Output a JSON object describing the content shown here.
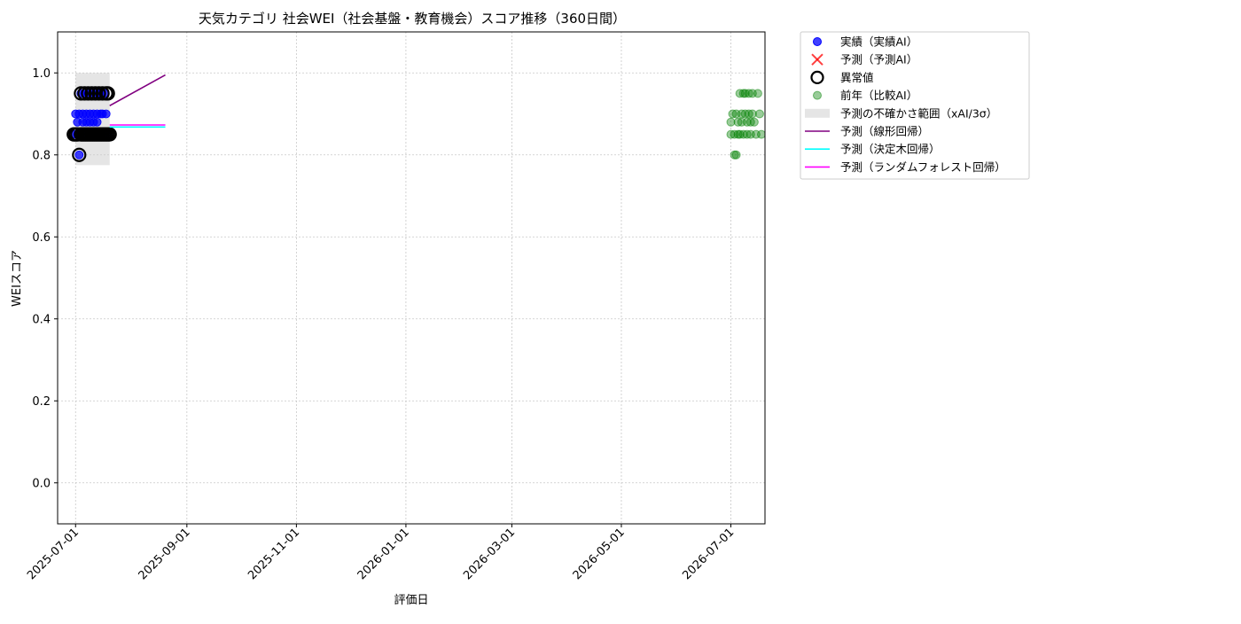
{
  "chart_data": {
    "type": "scatter",
    "title": "天気カテゴリ 社会WEI（社会基盤・教育機会）スコア推移（360日間）",
    "xlabel": "評価日",
    "ylabel": "WEIスコア",
    "xlim": [
      "2025-06-21",
      "2026-07-20"
    ],
    "ylim": [
      -0.1,
      1.1
    ],
    "xticks": [
      "2025-07-01",
      "2025-09-01",
      "2025-11-01",
      "2026-01-01",
      "2026-03-01",
      "2026-05-01",
      "2026-07-01"
    ],
    "yticks": [
      0.0,
      0.2,
      0.4,
      0.6,
      0.8,
      1.0
    ],
    "ytick_labels": [
      "0.0",
      "0.2",
      "0.4",
      "0.6",
      "0.8",
      "1.0"
    ],
    "grid": true,
    "legend_position": "outside-top-right",
    "colors": {
      "actual": "#0000ff",
      "predicted": "#ff0000",
      "anomaly": "#000000",
      "previous_year": "#008000",
      "band": "#cccccc",
      "linear": "#800080",
      "tree": "#00ffff",
      "forest": "#ff00ff"
    },
    "legend": [
      {
        "key": "actual",
        "label": "実績（実績AI）",
        "marker": "dot"
      },
      {
        "key": "predicted",
        "label": "予測（予測AI）",
        "marker": "x"
      },
      {
        "key": "anomaly",
        "label": "異常値",
        "marker": "ring"
      },
      {
        "key": "previous_year",
        "label": "前年（比較AI）",
        "marker": "dot-faint"
      },
      {
        "key": "band",
        "label": "予測の不確かさ範囲（xAI/3σ）",
        "marker": "patch"
      },
      {
        "key": "linear",
        "label": "予測（線形回帰）",
        "marker": "line"
      },
      {
        "key": "tree",
        "label": "予測（決定木回帰）",
        "marker": "line"
      },
      {
        "key": "forest",
        "label": "予測（ランダムフォレスト回帰）",
        "marker": "line"
      }
    ],
    "series": [
      {
        "key": "actual",
        "label": "実績（実績AI）",
        "points": [
          [
            "2025-07-01",
            0.85
          ],
          [
            "2025-07-01",
            0.9
          ],
          [
            "2025-07-02",
            0.88
          ],
          [
            "2025-07-02",
            0.85
          ],
          [
            "2025-07-03",
            0.8
          ],
          [
            "2025-07-03",
            0.9
          ],
          [
            "2025-07-04",
            0.95
          ],
          [
            "2025-07-04",
            0.85
          ],
          [
            "2025-07-05",
            0.88
          ],
          [
            "2025-07-05",
            0.9
          ],
          [
            "2025-07-06",
            0.95
          ],
          [
            "2025-07-06",
            0.85
          ],
          [
            "2025-07-07",
            0.9
          ],
          [
            "2025-07-07",
            0.88
          ],
          [
            "2025-07-08",
            0.95
          ],
          [
            "2025-07-08",
            0.85
          ],
          [
            "2025-07-09",
            0.9
          ],
          [
            "2025-07-09",
            0.88
          ],
          [
            "2025-07-10",
            0.95
          ],
          [
            "2025-07-10",
            0.85
          ],
          [
            "2025-07-11",
            0.9
          ],
          [
            "2025-07-11",
            0.88
          ],
          [
            "2025-07-12",
            0.95
          ],
          [
            "2025-07-12",
            0.85
          ],
          [
            "2025-07-13",
            0.9
          ],
          [
            "2025-07-13",
            0.88
          ],
          [
            "2025-07-14",
            0.95
          ],
          [
            "2025-07-14",
            0.85
          ],
          [
            "2025-07-15",
            0.9
          ],
          [
            "2025-07-15",
            0.95
          ],
          [
            "2025-07-16",
            0.85
          ],
          [
            "2025-07-16",
            0.9
          ],
          [
            "2025-07-17",
            0.95
          ],
          [
            "2025-07-17",
            0.85
          ],
          [
            "2025-07-18",
            0.9
          ],
          [
            "2025-07-19",
            0.85
          ]
        ]
      },
      {
        "key": "anomaly",
        "label": "異常値",
        "points": [
          [
            "2025-06-30",
            0.85
          ],
          [
            "2025-07-01",
            0.85
          ],
          [
            "2025-07-02",
            0.85
          ],
          [
            "2025-07-03",
            0.8
          ],
          [
            "2025-07-04",
            0.85
          ],
          [
            "2025-07-04",
            0.95
          ],
          [
            "2025-07-05",
            0.85
          ],
          [
            "2025-07-06",
            0.95
          ],
          [
            "2025-07-06",
            0.85
          ],
          [
            "2025-07-07",
            0.85
          ],
          [
            "2025-07-08",
            0.95
          ],
          [
            "2025-07-08",
            0.85
          ],
          [
            "2025-07-09",
            0.85
          ],
          [
            "2025-07-10",
            0.95
          ],
          [
            "2025-07-10",
            0.85
          ],
          [
            "2025-07-11",
            0.85
          ],
          [
            "2025-07-12",
            0.95
          ],
          [
            "2025-07-12",
            0.85
          ],
          [
            "2025-07-13",
            0.85
          ],
          [
            "2025-07-14",
            0.95
          ],
          [
            "2025-07-14",
            0.85
          ],
          [
            "2025-07-15",
            0.85
          ],
          [
            "2025-07-16",
            0.95
          ],
          [
            "2025-07-16",
            0.85
          ],
          [
            "2025-07-17",
            0.85
          ],
          [
            "2025-07-18",
            0.95
          ],
          [
            "2025-07-18",
            0.85
          ],
          [
            "2025-07-19",
            0.85
          ],
          [
            "2025-07-19",
            0.95
          ],
          [
            "2025-07-20",
            0.85
          ]
        ]
      },
      {
        "key": "previous_year",
        "label": "前年（比較AI）",
        "points": [
          [
            "2026-07-01",
            0.85
          ],
          [
            "2026-07-01",
            0.88
          ],
          [
            "2026-07-02",
            0.9
          ],
          [
            "2026-07-03",
            0.85
          ],
          [
            "2026-07-03",
            0.8
          ],
          [
            "2026-07-04",
            0.8
          ],
          [
            "2026-07-04",
            0.9
          ],
          [
            "2026-07-05",
            0.85
          ],
          [
            "2026-07-05",
            0.88
          ],
          [
            "2026-07-06",
            0.95
          ],
          [
            "2026-07-06",
            0.85
          ],
          [
            "2026-07-07",
            0.9
          ],
          [
            "2026-07-07",
            0.88
          ],
          [
            "2026-07-08",
            0.95
          ],
          [
            "2026-07-08",
            0.85
          ],
          [
            "2026-07-09",
            0.9
          ],
          [
            "2026-07-09",
            0.95
          ],
          [
            "2026-07-10",
            0.88
          ],
          [
            "2026-07-10",
            0.85
          ],
          [
            "2026-07-11",
            0.95
          ],
          [
            "2026-07-11",
            0.9
          ],
          [
            "2026-07-12",
            0.88
          ],
          [
            "2026-07-12",
            0.85
          ],
          [
            "2026-07-13",
            0.9
          ],
          [
            "2026-07-13",
            0.95
          ],
          [
            "2026-07-14",
            0.88
          ],
          [
            "2026-07-15",
            0.85
          ],
          [
            "2026-07-16",
            0.95
          ],
          [
            "2026-07-17",
            0.9
          ],
          [
            "2026-07-18",
            0.85
          ]
        ]
      }
    ],
    "band": {
      "x": [
        "2025-07-01",
        "2025-07-20"
      ],
      "y": [
        0.775,
        1.0
      ]
    },
    "prediction_lines": [
      {
        "key": "linear",
        "label": "予測（線形回帰）",
        "x": [
          "2025-07-20",
          "2025-08-20"
        ],
        "y": [
          0.92,
          0.995
        ]
      },
      {
        "key": "tree",
        "label": "予測（決定木回帰）",
        "x": [
          "2025-07-20",
          "2025-08-20"
        ],
        "y": [
          0.868,
          0.868
        ]
      },
      {
        "key": "forest",
        "label": "予測（ランダムフォレスト回帰）",
        "x": [
          "2025-07-20",
          "2025-08-20"
        ],
        "y": [
          0.873,
          0.873
        ]
      }
    ]
  }
}
